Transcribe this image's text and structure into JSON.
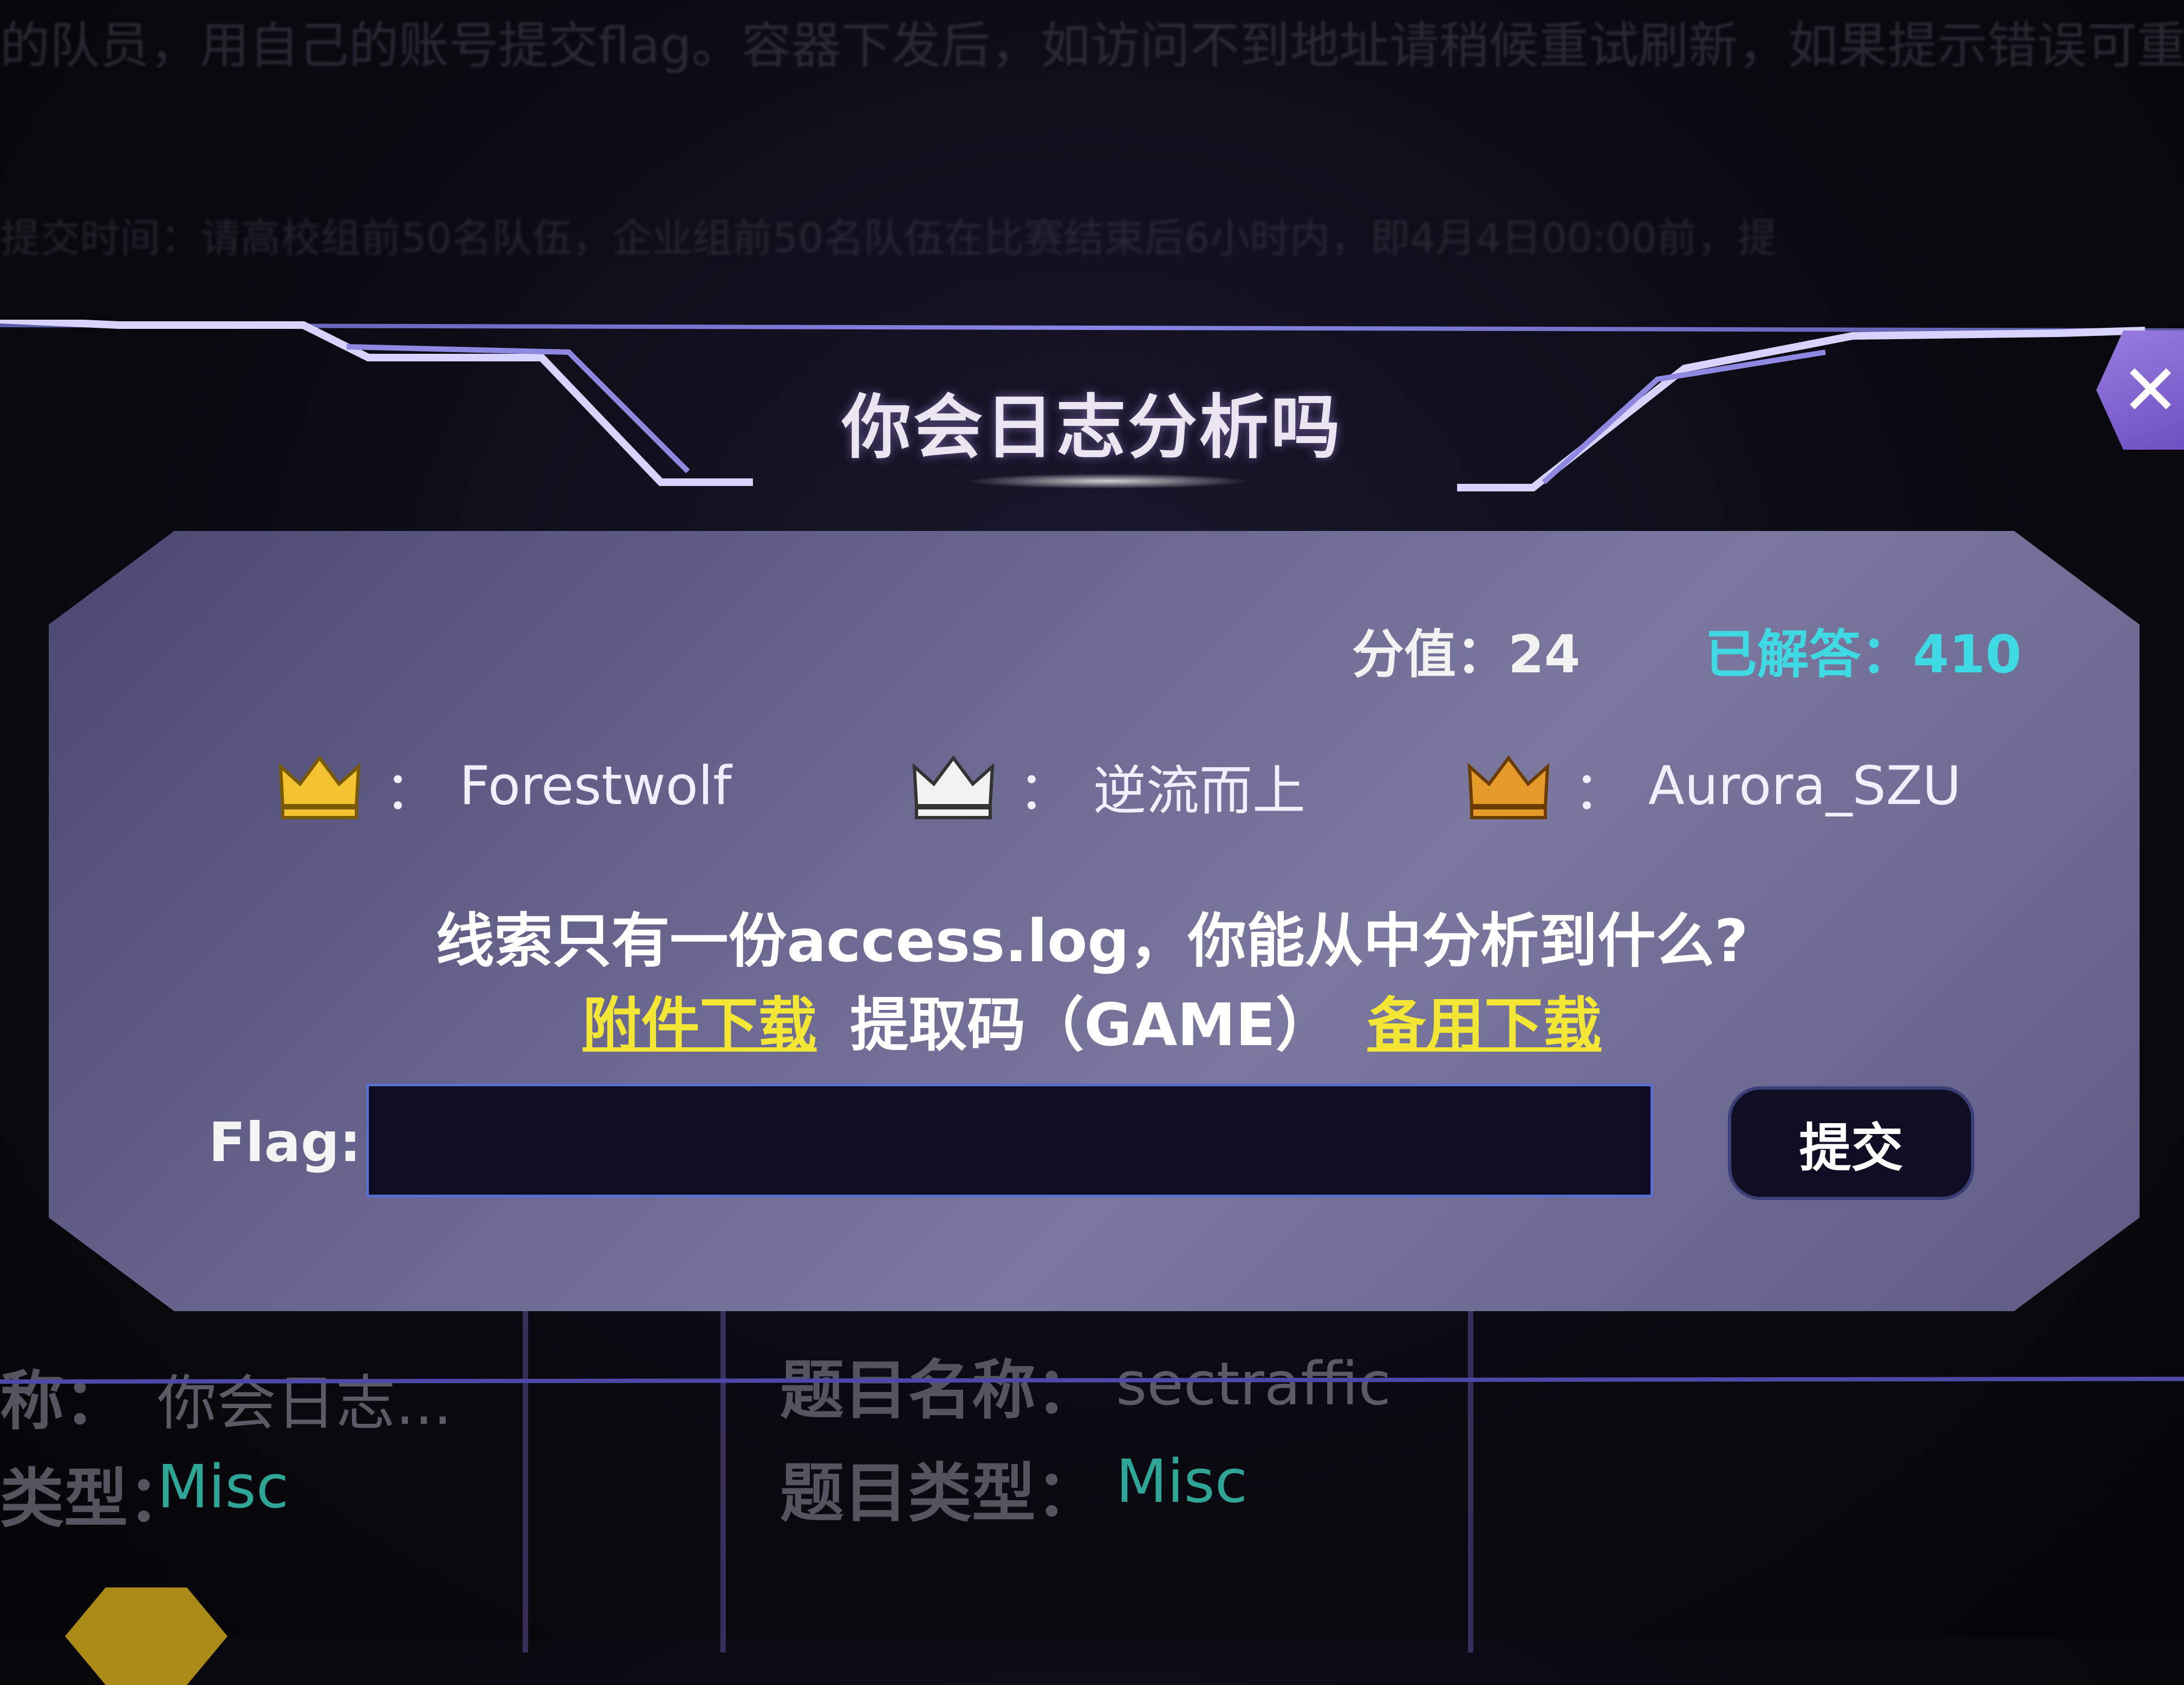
{
  "background": {
    "notice_line": "的队员，用自己的账号提交flag。容器下发后，如访问不到地址请稍候重试刷新，如果提示错误可重",
    "time_line": "提交时间：请高校组前50名队伍，企业组前50名队伍在比赛结束后6小时内，即4月4日00:00前，提",
    "cards": [
      {
        "name_label": "称：",
        "name_value": "你会日志...",
        "type_label": "类型：",
        "type_value": "Misc"
      },
      {
        "name_label": "题目名称：",
        "name_value": "sectraffic",
        "type_label": "题目类型：",
        "type_value": "Misc"
      }
    ]
  },
  "modal": {
    "title": "你会日志分析吗",
    "close_symbol": "✕",
    "score_text": "分值：24",
    "solved_text": "已解答：410",
    "colors": {
      "accent": "#3ed9e3",
      "link": "#f3e634",
      "gold": "#f2c230",
      "silver": "#f2f2f2",
      "bronze": "#e59a2a"
    },
    "ranks": [
      {
        "medal": "gold-crown-icon",
        "sep": "：",
        "name": "Forestwolf"
      },
      {
        "medal": "silver-crown-icon",
        "sep": "：",
        "name": "逆流而上"
      },
      {
        "medal": "bronze-crown-icon",
        "sep": "：",
        "name": "Aurora_SZU"
      }
    ],
    "question": "线索只有一份access.log，你能从中分析到什么?",
    "download_label": "附件下载",
    "code_text": "提取码（GAME）",
    "backup_label": "备用下载",
    "flag_label": "Flag:",
    "flag_value": "",
    "submit_label": "提交"
  }
}
